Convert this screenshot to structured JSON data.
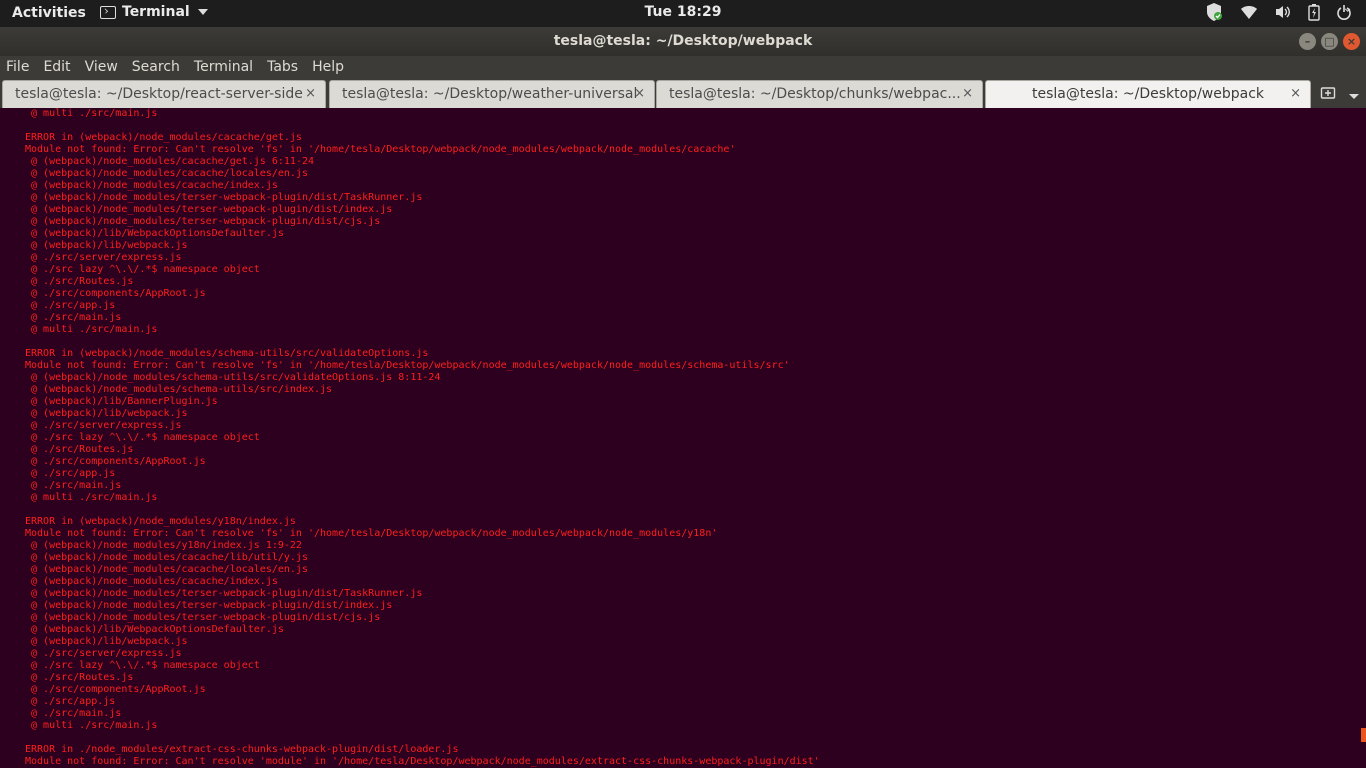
{
  "topbar": {
    "activities": "Activities",
    "app_name": "Terminal",
    "clock": "Tue 18:29"
  },
  "window": {
    "title": "tesla@tesla: ~/Desktop/webpack",
    "close_glyph": "×",
    "minimize_glyph": "–",
    "maximize_glyph": "□"
  },
  "menu": {
    "file": "File",
    "edit": "Edit",
    "view": "View",
    "search": "Search",
    "terminal": "Terminal",
    "tabs": "Tabs",
    "help": "Help"
  },
  "tabs": [
    {
      "label": "tesla@tesla: ~/Desktop/react-server-side",
      "active": false
    },
    {
      "label": "tesla@tesla: ~/Desktop/weather-universal",
      "active": false
    },
    {
      "label": "tesla@tesla: ~/Desktop/chunks/webpac...",
      "active": false
    },
    {
      "label": "tesla@tesla: ~/Desktop/webpack",
      "active": true
    }
  ],
  "tab_close_glyph": "×",
  "icons": [
    "terminal-icon",
    "shield-icon",
    "wifi-icon",
    "volume-icon",
    "battery-icon",
    "power-icon",
    "new-tab-icon",
    "tab-menu-icon"
  ],
  "colors": {
    "terminal_bg": "#2c001e",
    "error_text": "#ff1f1f",
    "accent": "#e95420"
  },
  "terminal_lines": [
    " @ multi ./src/main.js",
    "",
    "ERROR in (webpack)/node_modules/cacache/get.js",
    "Module not found: Error: Can't resolve 'fs' in '/home/tesla/Desktop/webpack/node_modules/webpack/node_modules/cacache'",
    " @ (webpack)/node_modules/cacache/get.js 6:11-24",
    " @ (webpack)/node_modules/cacache/locales/en.js",
    " @ (webpack)/node_modules/cacache/index.js",
    " @ (webpack)/node_modules/terser-webpack-plugin/dist/TaskRunner.js",
    " @ (webpack)/node_modules/terser-webpack-plugin/dist/index.js",
    " @ (webpack)/node_modules/terser-webpack-plugin/dist/cjs.js",
    " @ (webpack)/lib/WebpackOptionsDefaulter.js",
    " @ (webpack)/lib/webpack.js",
    " @ ./src/server/express.js",
    " @ ./src lazy ^\\.\\/.*$ namespace object",
    " @ ./src/Routes.js",
    " @ ./src/components/AppRoot.js",
    " @ ./src/app.js",
    " @ ./src/main.js",
    " @ multi ./src/main.js",
    "",
    "ERROR in (webpack)/node_modules/schema-utils/src/validateOptions.js",
    "Module not found: Error: Can't resolve 'fs' in '/home/tesla/Desktop/webpack/node_modules/webpack/node_modules/schema-utils/src'",
    " @ (webpack)/node_modules/schema-utils/src/validateOptions.js 8:11-24",
    " @ (webpack)/node_modules/schema-utils/src/index.js",
    " @ (webpack)/lib/BannerPlugin.js",
    " @ (webpack)/lib/webpack.js",
    " @ ./src/server/express.js",
    " @ ./src lazy ^\\.\\/.*$ namespace object",
    " @ ./src/Routes.js",
    " @ ./src/components/AppRoot.js",
    " @ ./src/app.js",
    " @ ./src/main.js",
    " @ multi ./src/main.js",
    "",
    "ERROR in (webpack)/node_modules/y18n/index.js",
    "Module not found: Error: Can't resolve 'fs' in '/home/tesla/Desktop/webpack/node_modules/webpack/node_modules/y18n'",
    " @ (webpack)/node_modules/y18n/index.js 1:9-22",
    " @ (webpack)/node_modules/cacache/lib/util/y.js",
    " @ (webpack)/node_modules/cacache/locales/en.js",
    " @ (webpack)/node_modules/cacache/index.js",
    " @ (webpack)/node_modules/terser-webpack-plugin/dist/TaskRunner.js",
    " @ (webpack)/node_modules/terser-webpack-plugin/dist/index.js",
    " @ (webpack)/node_modules/terser-webpack-plugin/dist/cjs.js",
    " @ (webpack)/lib/WebpackOptionsDefaulter.js",
    " @ (webpack)/lib/webpack.js",
    " @ ./src/server/express.js",
    " @ ./src lazy ^\\.\\/.*$ namespace object",
    " @ ./src/Routes.js",
    " @ ./src/components/AppRoot.js",
    " @ ./src/app.js",
    " @ ./src/main.js",
    " @ multi ./src/main.js",
    "",
    "ERROR in ./node_modules/extract-css-chunks-webpack-plugin/dist/loader.js",
    "Module not found: Error: Can't resolve 'module' in '/home/tesla/Desktop/webpack/node_modules/extract-css-chunks-webpack-plugin/dist'"
  ]
}
